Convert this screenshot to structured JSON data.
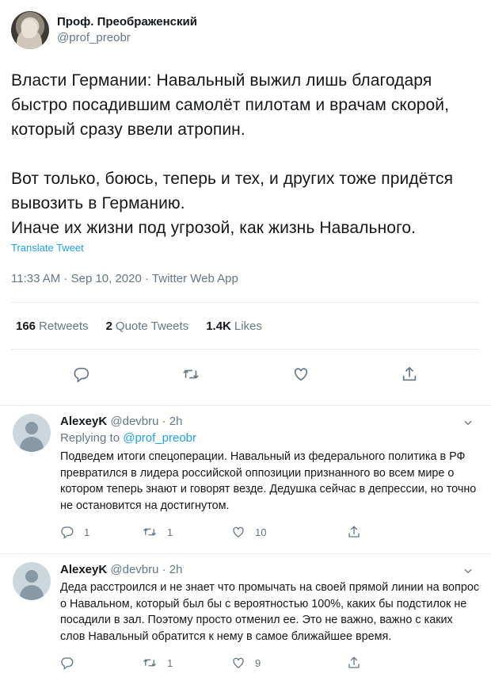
{
  "tweet": {
    "author_name": "Проф. Преображенский",
    "author_handle": "@prof_preobr",
    "text": "Власти Германии: Навальный выжил лишь благодаря быстро посадившим самолёт пилотам и врачам скорой, который сразу ввели атропин.\n\nВот только, боюсь, теперь и тех, и других тоже придётся вывозить в Германию.\nИначе их жизни под угрозой, как жизнь Навального.",
    "translate_label": "Translate Tweet",
    "meta": "11:33 AM · Sep 10, 2020 · Twitter Web App",
    "retweets_count": "166",
    "retweets_label": "Retweets",
    "quotes_count": "2",
    "quotes_label": "Quote Tweets",
    "likes_count": "1.4K",
    "likes_label": "Likes"
  },
  "replies": [
    {
      "name": "AlexeyK",
      "handle": "@devbru",
      "time": "· 2h",
      "replying_prefix": "Replying to",
      "replying_to": "@prof_preobr",
      "text": "Подведем итоги спецоперации. Навальный из федерального политика в РФ превратился в лидера российской оппозиции признанного во всем мире о котором теперь знают и говорят везде. Дедушка сейчас в депрессии, но точно не остановится на достигнутом.",
      "replies": "1",
      "retweets": "1",
      "likes": "10"
    },
    {
      "name": "AlexeyK",
      "handle": "@devbru",
      "time": "· 2h",
      "text": "Деда расстроился и не знает что промычать на своей прямой линии на вопрос о Навальном, который был бы с вероятностью 100%, каких бы подстилок не посадили в зал. Поэтому просто отменил ее. Это не важно, важно с каких слов Навальный обратится к нему в самое ближайшее время.",
      "replies": "",
      "retweets": "1",
      "likes": "9"
    }
  ],
  "icons": [
    "reply-icon",
    "retweet-icon",
    "like-icon",
    "share-icon",
    "chevron-down-icon"
  ],
  "colors": {
    "accent": "#1da1f2",
    "muted": "#657786",
    "text": "#14171a",
    "divider": "#e6ecf0"
  }
}
